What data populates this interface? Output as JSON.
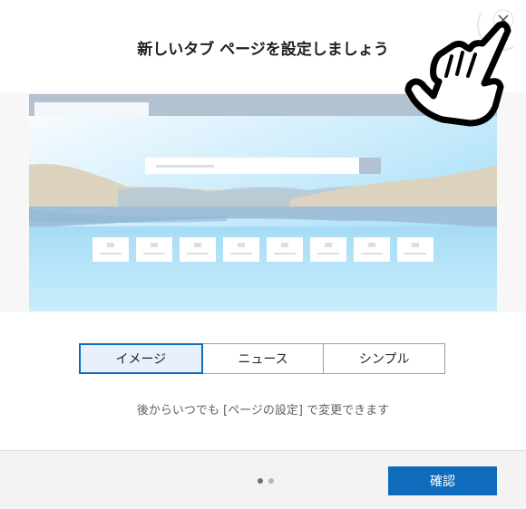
{
  "dialog": {
    "title": "新しいタブ ページを設定しましょう",
    "close_label": "×"
  },
  "layout_options": [
    {
      "label": "イメージ",
      "selected": true
    },
    {
      "label": "ニュース",
      "selected": false
    },
    {
      "label": "シンプル",
      "selected": false
    }
  ],
  "hint": "後からいつでも [ページの設定] で変更できます",
  "footer": {
    "page_count": 2,
    "current_page": 1,
    "confirm_label": "確認"
  },
  "colors": {
    "accent": "#0f6cbd",
    "preview_sky": "#a8dcf7",
    "preview_sand": "#ddd4bd",
    "preview_tab": "#b3c2d1"
  },
  "icons": {
    "close": "close-icon",
    "pointer": "hand-pointer-icon"
  }
}
